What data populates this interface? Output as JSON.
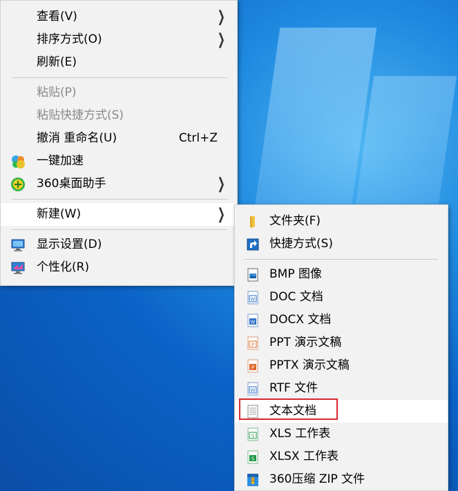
{
  "context_menu": {
    "items": [
      {
        "label": "查看(V)",
        "has_submenu": true
      },
      {
        "label": "排序方式(O)",
        "has_submenu": true
      },
      {
        "label": "刷新(E)"
      },
      {
        "label": "粘贴(P)",
        "disabled": true
      },
      {
        "label": "粘贴快捷方式(S)",
        "disabled": true
      },
      {
        "label": "撤消 重命名(U)",
        "shortcut": "Ctrl+Z"
      },
      {
        "label": "一键加速",
        "icon": "speedup-icon"
      },
      {
        "label": "360桌面助手",
        "icon": "360-assistant-icon",
        "has_submenu": true
      },
      {
        "label": "新建(W)",
        "has_submenu": true,
        "highlighted": true
      },
      {
        "label": "显示设置(D)",
        "icon": "display-settings-icon"
      },
      {
        "label": "个性化(R)",
        "icon": "personalize-icon"
      }
    ]
  },
  "new_submenu": {
    "items": [
      {
        "label": "文件夹(F)",
        "icon": "folder-icon"
      },
      {
        "label": "快捷方式(S)",
        "icon": "shortcut-icon"
      },
      {
        "label": "BMP 图像",
        "icon": "bmp-file-icon"
      },
      {
        "label": "DOC 文档",
        "icon": "doc-file-icon"
      },
      {
        "label": "DOCX 文档",
        "icon": "docx-file-icon"
      },
      {
        "label": "PPT 演示文稿",
        "icon": "ppt-file-icon"
      },
      {
        "label": "PPTX 演示文稿",
        "icon": "pptx-file-icon"
      },
      {
        "label": "RTF 文件",
        "icon": "rtf-file-icon"
      },
      {
        "label": "文本文档",
        "icon": "text-file-icon",
        "highlighted": true
      },
      {
        "label": "XLS 工作表",
        "icon": "xls-file-icon"
      },
      {
        "label": "XLSX 工作表",
        "icon": "xlsx-file-icon"
      },
      {
        "label": "360压缩 ZIP 文件",
        "icon": "zip-file-icon"
      }
    ]
  },
  "colors": {
    "menu_bg": "#f2f2f2",
    "highlight_bg": "#ffffff",
    "disabled_text": "#8a8a8a",
    "annotation_box": "#d9262c",
    "desktop_blue": "#0b63c7"
  }
}
